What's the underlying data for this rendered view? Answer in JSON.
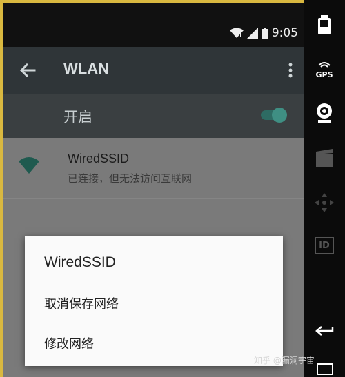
{
  "status_bar": {
    "time": "9:05"
  },
  "toolbar": {
    "title": "WLAN"
  },
  "switch_bar": {
    "label": "开启",
    "state": "on"
  },
  "network": {
    "name": "WiredSSID",
    "status": "已连接，但无法访问互联网"
  },
  "dialog": {
    "title": "WiredSSID",
    "items": [
      {
        "label": "取消保存网络"
      },
      {
        "label": "修改网络"
      }
    ]
  },
  "emulator_controls": {
    "gps_label": "GPS",
    "id_label": "ID"
  },
  "watermark": {
    "text": "知乎 @漏洞宇宙"
  },
  "colors": {
    "accent": "#3f8f83",
    "toolbar": "#2f3538",
    "switch_bar": "#3a3f41",
    "content": "#7a7a7a"
  },
  "icons": [
    "back-arrow-icon",
    "overflow-menu-icon",
    "wifi-signal-icon",
    "cell-signal-icon",
    "battery-icon",
    "wifi-full-icon"
  ]
}
